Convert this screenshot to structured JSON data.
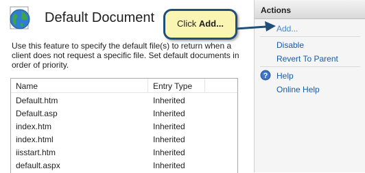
{
  "feature": {
    "title": "Default Document",
    "description": "Use this feature to specify the default file(s) to return when a client does not request a specific file. Set default documents in order of priority."
  },
  "table": {
    "columns": [
      "Name",
      "Entry Type"
    ],
    "rows": [
      {
        "name": "Default.htm",
        "type": "Inherited"
      },
      {
        "name": "Default.asp",
        "type": "Inherited"
      },
      {
        "name": "index.htm",
        "type": "Inherited"
      },
      {
        "name": "index.html",
        "type": "Inherited"
      },
      {
        "name": "iisstart.htm",
        "type": "Inherited"
      },
      {
        "name": "default.aspx",
        "type": "Inherited"
      }
    ]
  },
  "callout": {
    "prefix": "Click ",
    "bold": "Add..."
  },
  "actions": {
    "title": "Actions",
    "add": "Add...",
    "disable": "Disable",
    "revert": "Revert To Parent",
    "help": "Help",
    "online_help": "Online Help"
  },
  "icons": {
    "feature": "globe-document-icon",
    "help": "help-icon",
    "pointer": "arrow-icon"
  },
  "colors": {
    "link": "#1a5aa3",
    "callout_bg": "#fbf5b4",
    "callout_border": "#1f4e79"
  }
}
